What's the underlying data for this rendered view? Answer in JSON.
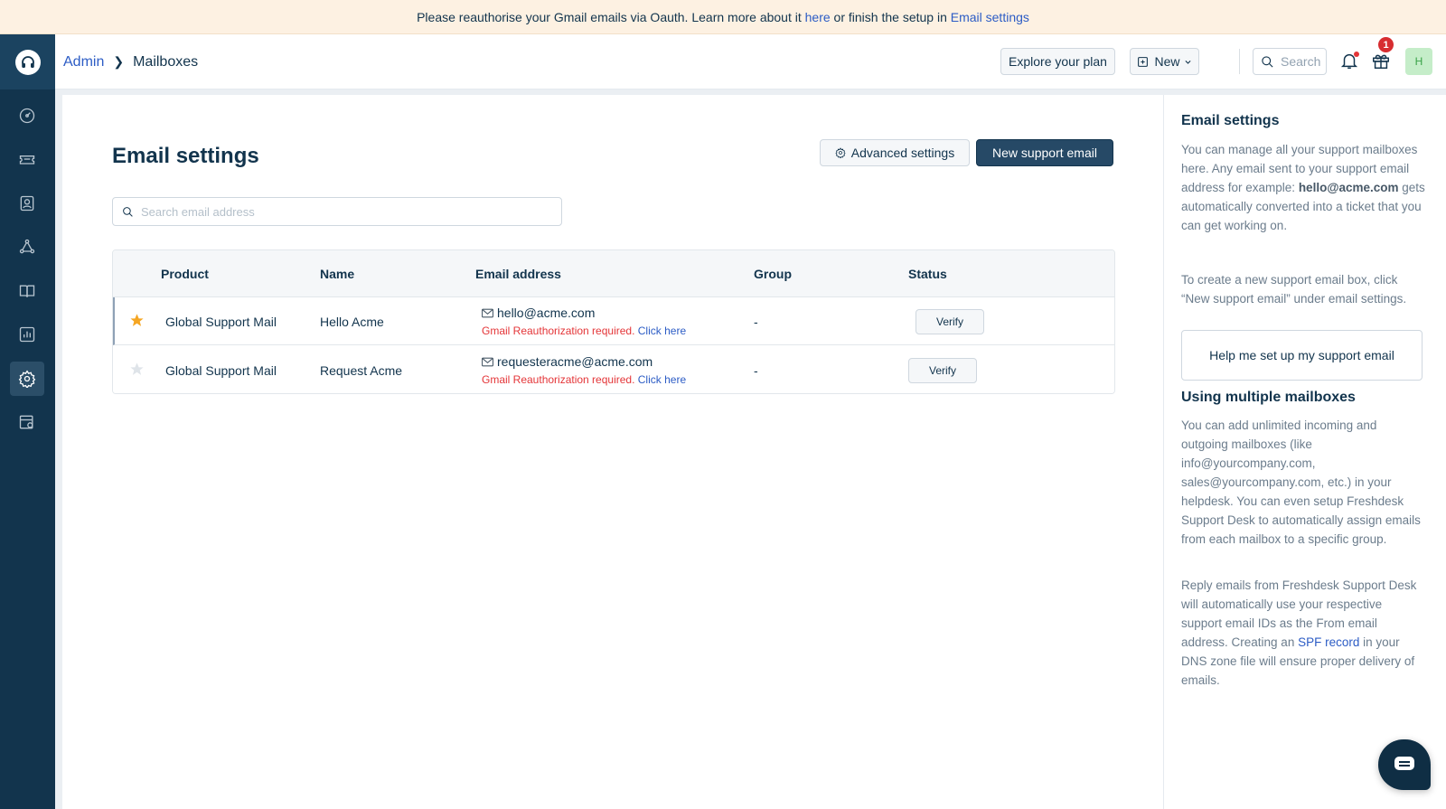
{
  "banner": {
    "text_before": "Please reauthorise your Gmail emails via Oauth. Learn more about it ",
    "link_here": "here",
    "text_middle": " or finish the setup in ",
    "link_settings": "Email settings"
  },
  "header": {
    "breadcrumb_admin": "Admin",
    "breadcrumb_page": "Mailboxes",
    "explore_label": "Explore your plan",
    "new_label": "New",
    "search_label": "Search",
    "gift_badge": "1",
    "avatar_initial": "H"
  },
  "sidebar": {
    "items": [
      "dashboard-icon",
      "tickets-icon",
      "contacts-icon",
      "social-icon",
      "solutions-icon",
      "reports-icon",
      "admin-gear-icon",
      "apps-icon"
    ],
    "active": "admin-gear-icon"
  },
  "main": {
    "title": "Email settings",
    "advanced_label": "Advanced settings",
    "new_support_label": "New support email",
    "search_placeholder": "Search email address",
    "columns": [
      "Product",
      "Name",
      "Email address",
      "Group",
      "Status"
    ],
    "rows": [
      {
        "starred": true,
        "product": "Global Support Mail",
        "name": "Hello Acme",
        "email": "hello@acme.com",
        "warning": "Gmail Reauthorization required.",
        "warning_link": "Click here",
        "group": "-",
        "status_action": "Verify"
      },
      {
        "starred": false,
        "product": "Global Support Mail",
        "name": "Request Acme",
        "email": "requesteracme@acme.com",
        "warning": "Gmail Reauthorization required.",
        "warning_link": "Click here",
        "group": "-",
        "status_action": "Verify"
      }
    ]
  },
  "panel": {
    "heading1": "Email settings",
    "p1_before": "You can manage all your support mailboxes here. Any email sent to your support email address for example: ",
    "p1_bold": "hello@acme.com",
    "p1_after": " gets automatically converted into a ticket that you can get working on.",
    "p2": "To create a new support email box, click “New support email” under email settings.",
    "help_button": "Help me set up my support email",
    "heading2": "Using multiple mailboxes",
    "p3": "You can add unlimited incoming and outgoing mailboxes (like info@yourcompany.com, sales@yourcompany.com, etc.) in your helpdesk. You can even setup Freshdesk Support Desk to automatically assign emails from each mailbox to a specific group.",
    "p4_before": "Reply emails from Freshdesk Support Desk will automatically use your respective support email IDs as the From email address. Creating an ",
    "p4_link": "SPF record",
    "p4_after": " in your DNS zone file will ensure proper delivery of emails."
  },
  "colors": {
    "sidebar": "#12344d",
    "primary_button": "#264966",
    "link": "#2c5cc5",
    "warning": "#e43538",
    "star_active": "#f5a623",
    "star_inactive": "#cfd7df"
  }
}
